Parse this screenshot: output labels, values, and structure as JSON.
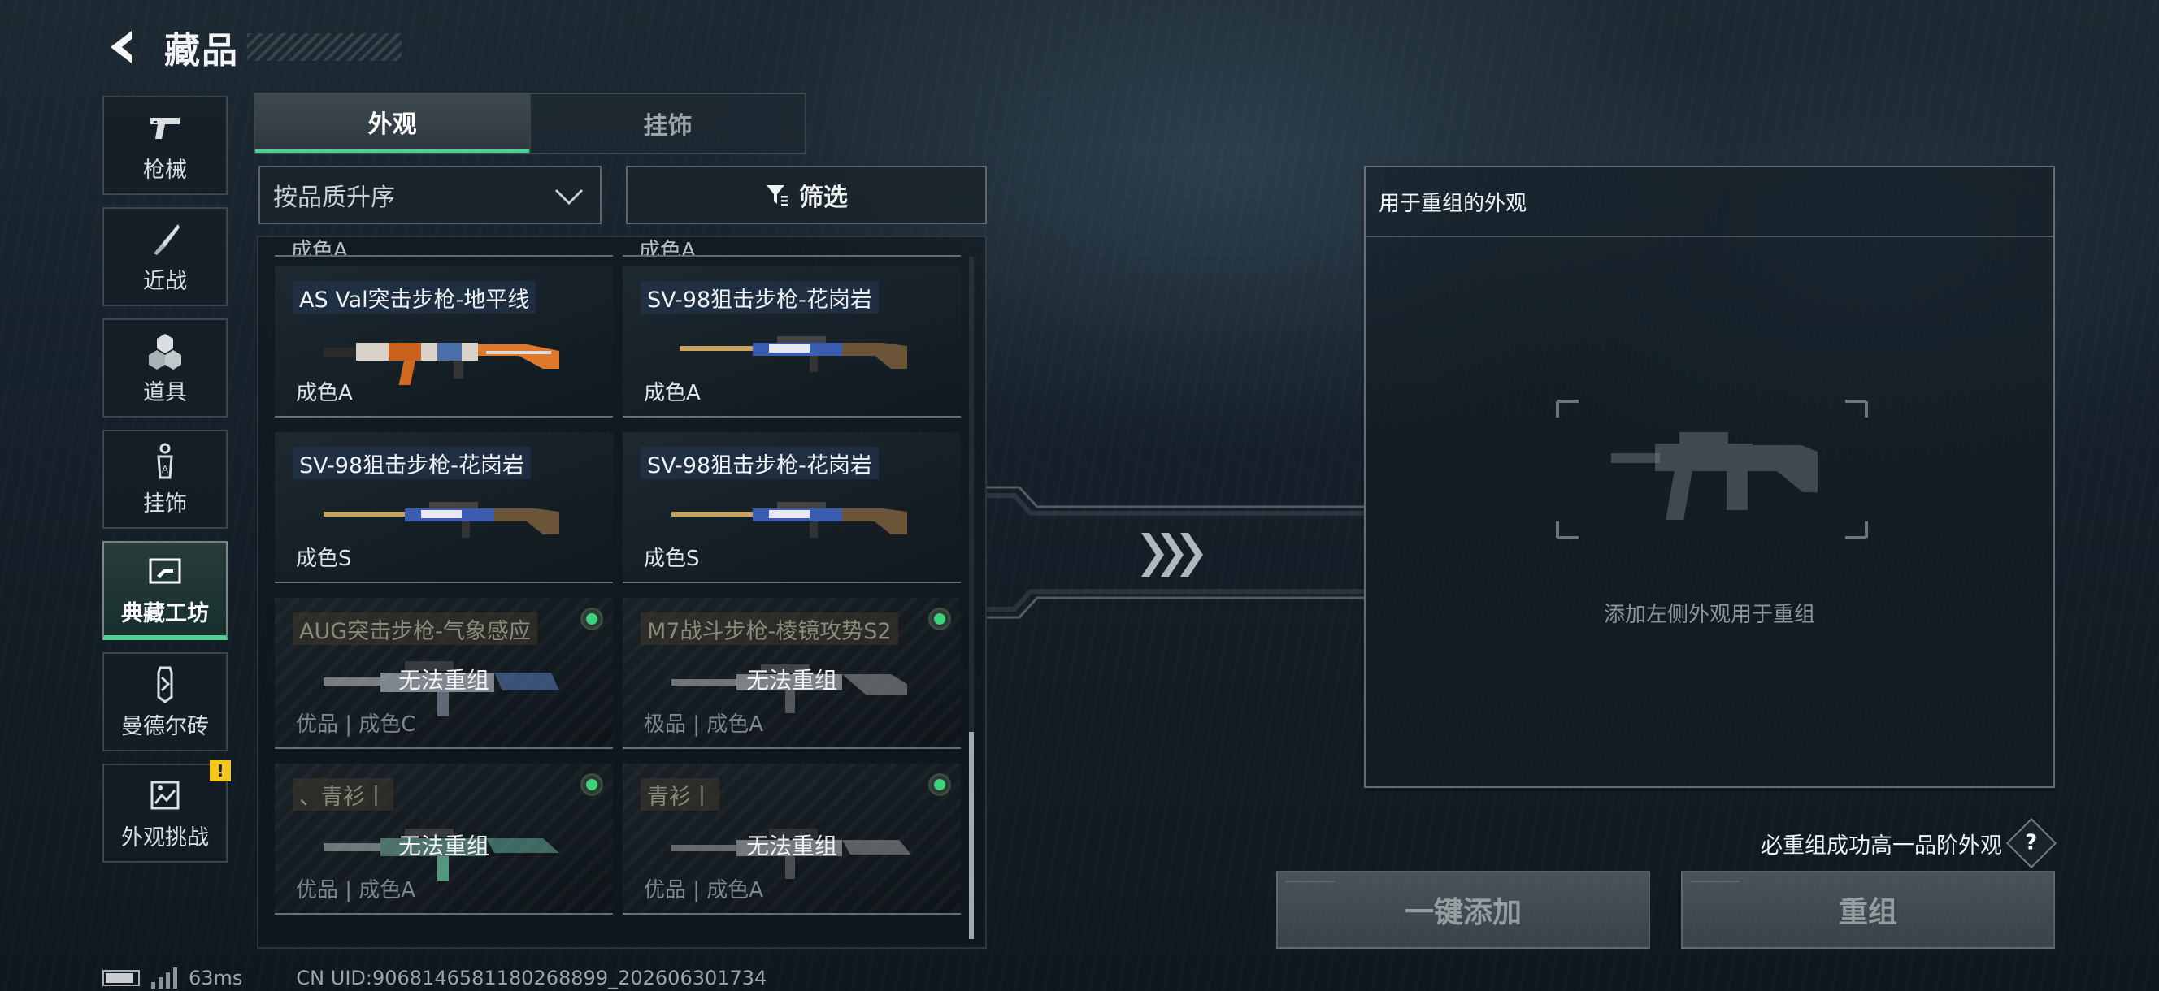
{
  "header": {
    "title": "藏品"
  },
  "nav": [
    {
      "label": "枪械",
      "icon": "pistol-icon"
    },
    {
      "label": "近战",
      "icon": "knife-icon"
    },
    {
      "label": "道具",
      "icon": "grenade-cluster-icon"
    },
    {
      "label": "挂饰",
      "icon": "charm-icon"
    },
    {
      "label": "典藏工坊",
      "icon": "workshop-icon",
      "active": true
    },
    {
      "label": "曼德尔砖",
      "icon": "brick-icon"
    },
    {
      "label": "外观挑战",
      "icon": "challenge-icon",
      "badge": "!"
    }
  ],
  "tabs": [
    {
      "label": "外观",
      "active": true
    },
    {
      "label": "挂饰",
      "active": false
    }
  ],
  "sort": {
    "value": "按品质升序"
  },
  "filter": {
    "label": "筛选"
  },
  "partial_row": [
    "成色A",
    "成色A"
  ],
  "cards": [
    {
      "name": "AS Val突击步枪-地平线",
      "quality": "成色A",
      "locked": false
    },
    {
      "name": "SV-98狙击步枪-花岗岩",
      "quality": "成色A",
      "locked": false
    },
    {
      "name": "SV-98狙击步枪-花岗岩",
      "quality": "成色S",
      "locked": false
    },
    {
      "name": "SV-98狙击步枪-花岗岩",
      "quality": "成色S",
      "locked": false
    },
    {
      "name": "AUG突击步枪-气象感应",
      "quality": "优品 | 成色C",
      "locked": true,
      "lock_text": "无法重组"
    },
    {
      "name": "M7战斗步枪-棱镜攻势S2",
      "quality": "极品 | 成色A",
      "locked": true,
      "lock_text": "无法重组"
    },
    {
      "name": "、青衫丨",
      "quality": "优品 | 成色A",
      "locked": true,
      "lock_text": "无法重组"
    },
    {
      "name": "青衫丨",
      "quality": "优品 | 成色A",
      "locked": true,
      "lock_text": "无法重组"
    }
  ],
  "recombine": {
    "title": "用于重组的外观",
    "hint": "添加左侧外观用于重组",
    "tip": "必重组成功高一品阶外观",
    "help": "?",
    "add_button": "一键添加",
    "recombine_button": "重组"
  },
  "status": {
    "ping": "63ms",
    "uid": "CN UID:9068146581180268899_202606301734"
  },
  "colors": {
    "accent": "#4ecf94",
    "badge": "#f2c61f",
    "owned_dot": "#3ed37a"
  }
}
